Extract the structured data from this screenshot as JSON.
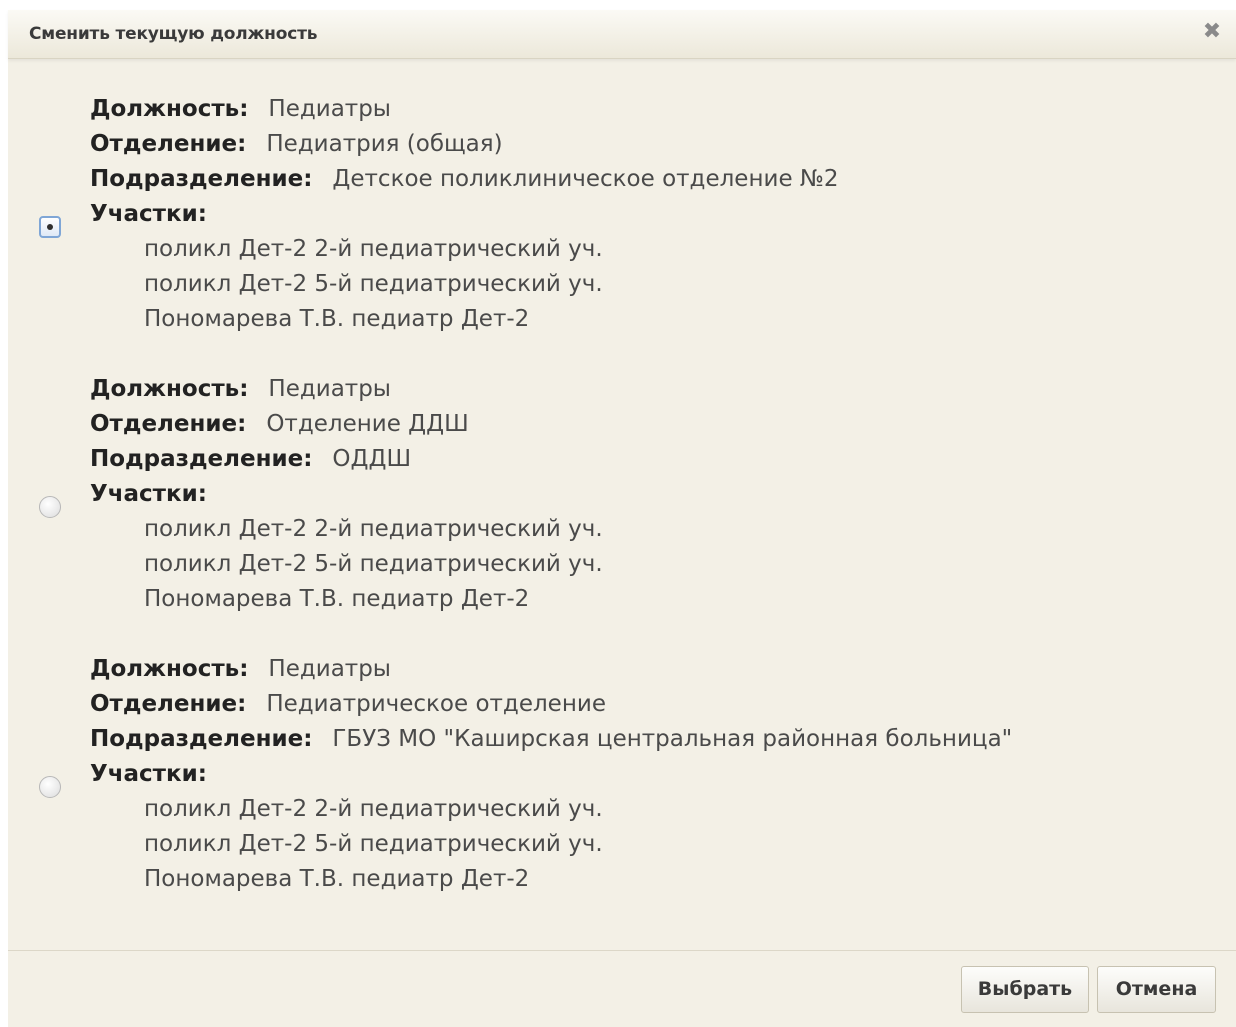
{
  "dialog": {
    "title": "Сменить текущую должность",
    "close_icon": "close-icon"
  },
  "labels": {
    "position": "Должность:",
    "department": "Отделение:",
    "subdivision": "Подразделение:",
    "sites": "Участки:"
  },
  "options": [
    {
      "selected": true,
      "position": "Педиатры",
      "department": "Педиатрия (общая)",
      "subdivision": "Детское поликлиническое отделение №2",
      "sites": [
        "поликл Дет-2 2-й педиатрический уч.",
        "поликл Дет-2 5-й педиатрический уч.",
        "Пономарева Т.В. педиатр Дет-2"
      ]
    },
    {
      "selected": false,
      "position": "Педиатры",
      "department": "Отделение ДДШ",
      "subdivision": "ОДДШ",
      "sites": [
        "поликл Дет-2 2-й педиатрический уч.",
        "поликл Дет-2 5-й педиатрический уч.",
        "Пономарева Т.В. педиатр Дет-2"
      ]
    },
    {
      "selected": false,
      "position": "Педиатры",
      "department": "Педиатрическое отделение",
      "subdivision": "ГБУЗ МО \"Каширская центральная районная больница\"",
      "sites": [
        "поликл Дет-2 2-й педиатрический уч.",
        "поликл Дет-2 5-й педиатрический уч.",
        "Пономарева Т.В. педиатр Дет-2"
      ]
    }
  ],
  "footer": {
    "select_label": "Выбрать",
    "cancel_label": "Отмена"
  }
}
